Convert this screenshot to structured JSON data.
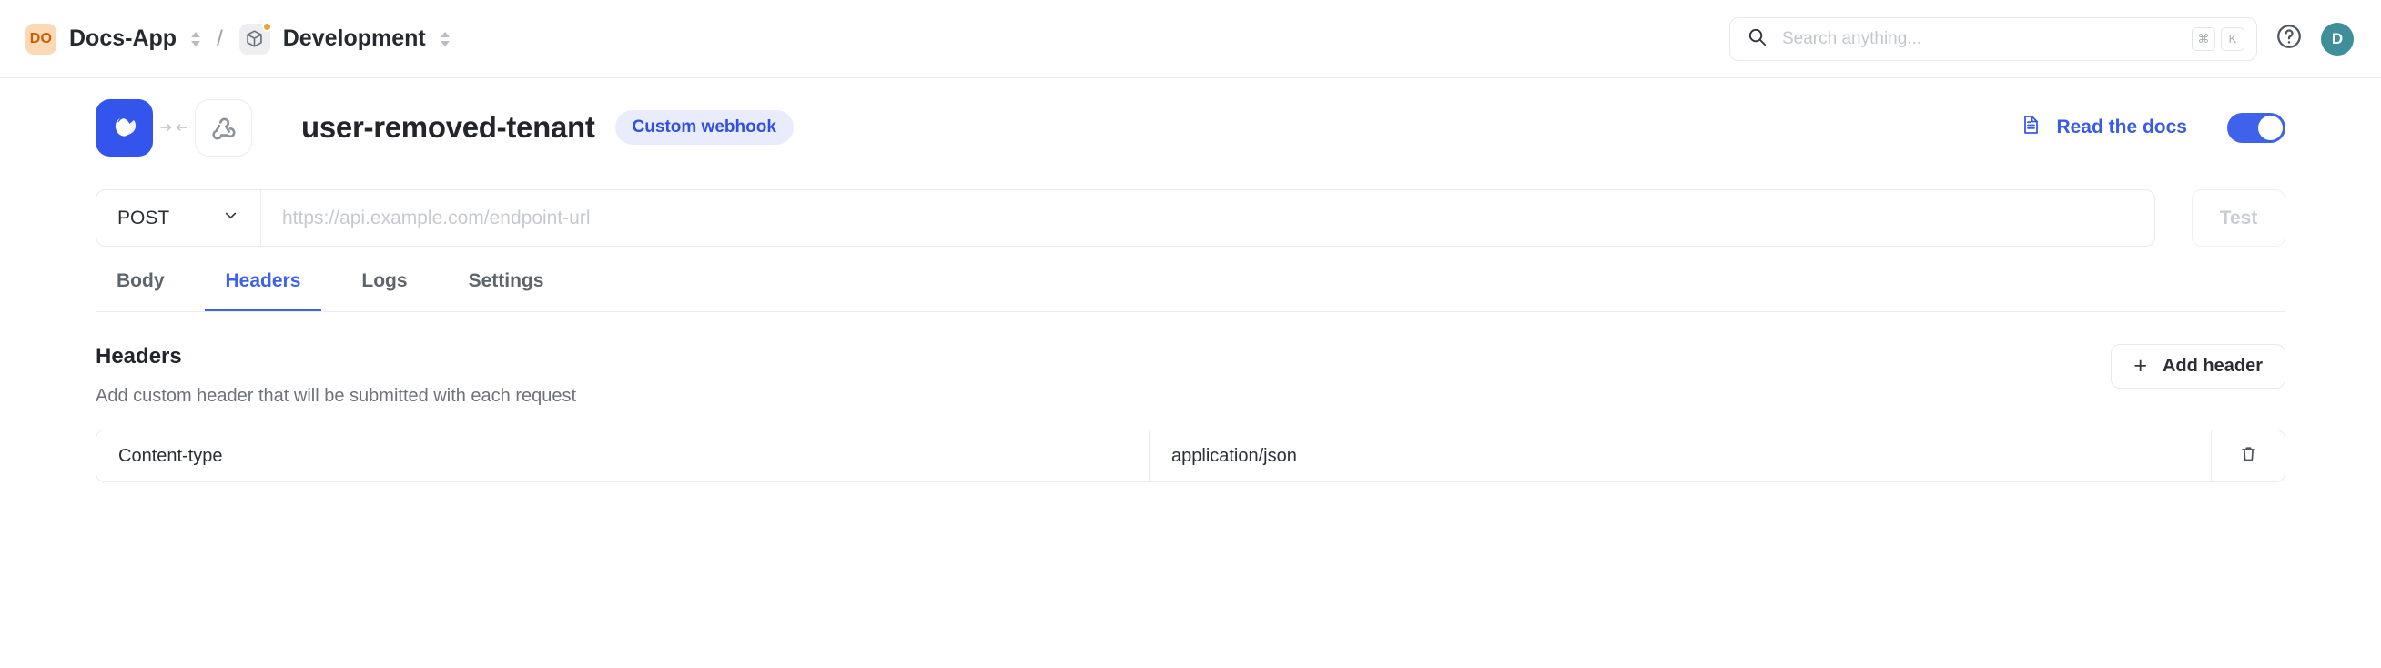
{
  "topbar": {
    "org": {
      "avatar_initials": "DO",
      "name": "Docs-App",
      "avatar_bg": "#fbd9b5",
      "avatar_fg": "#c2610a"
    },
    "separator": "/",
    "project": {
      "name": "Development",
      "icon": "cube-icon",
      "has_notification_dot": true
    },
    "search": {
      "placeholder": "Search anything...",
      "icon": "search-icon",
      "shortcut_keys": [
        "⌘",
        "K"
      ]
    },
    "help": {
      "icon": "help-circle-icon"
    },
    "user": {
      "initial": "D",
      "avatar_bg": "#3e8e9c"
    }
  },
  "hero": {
    "app_icon": "app-logo-icon",
    "connector_icon": "arrows-connect-icon",
    "webhook_icon": "webhook-icon",
    "title": "user-removed-tenant",
    "badge": "Custom webhook",
    "badge_bg": "#e9ecfd",
    "badge_fg": "#2f4fe8",
    "docs_link": {
      "label": "Read the docs",
      "icon": "document-icon",
      "color": "#3a5ae8"
    },
    "enabled_toggle": {
      "state": "on",
      "color": "#3f62ec"
    }
  },
  "request": {
    "method": "POST",
    "method_chevron": "chevron-down-icon",
    "url_value": "",
    "url_placeholder": "https://api.example.com/endpoint-url",
    "test_label": "Test",
    "test_disabled": true
  },
  "tabs": [
    {
      "label": "Body",
      "active": false
    },
    {
      "label": "Headers",
      "active": true
    },
    {
      "label": "Logs",
      "active": false
    },
    {
      "label": "Settings",
      "active": false
    }
  ],
  "headers_section": {
    "title": "Headers",
    "description": "Add custom header that will be submitted with each request",
    "add_button": {
      "label": "Add header",
      "icon": "plus-icon"
    },
    "rows": [
      {
        "key": "Content-type",
        "value": "application/json",
        "delete_icon": "trash-icon"
      }
    ]
  }
}
